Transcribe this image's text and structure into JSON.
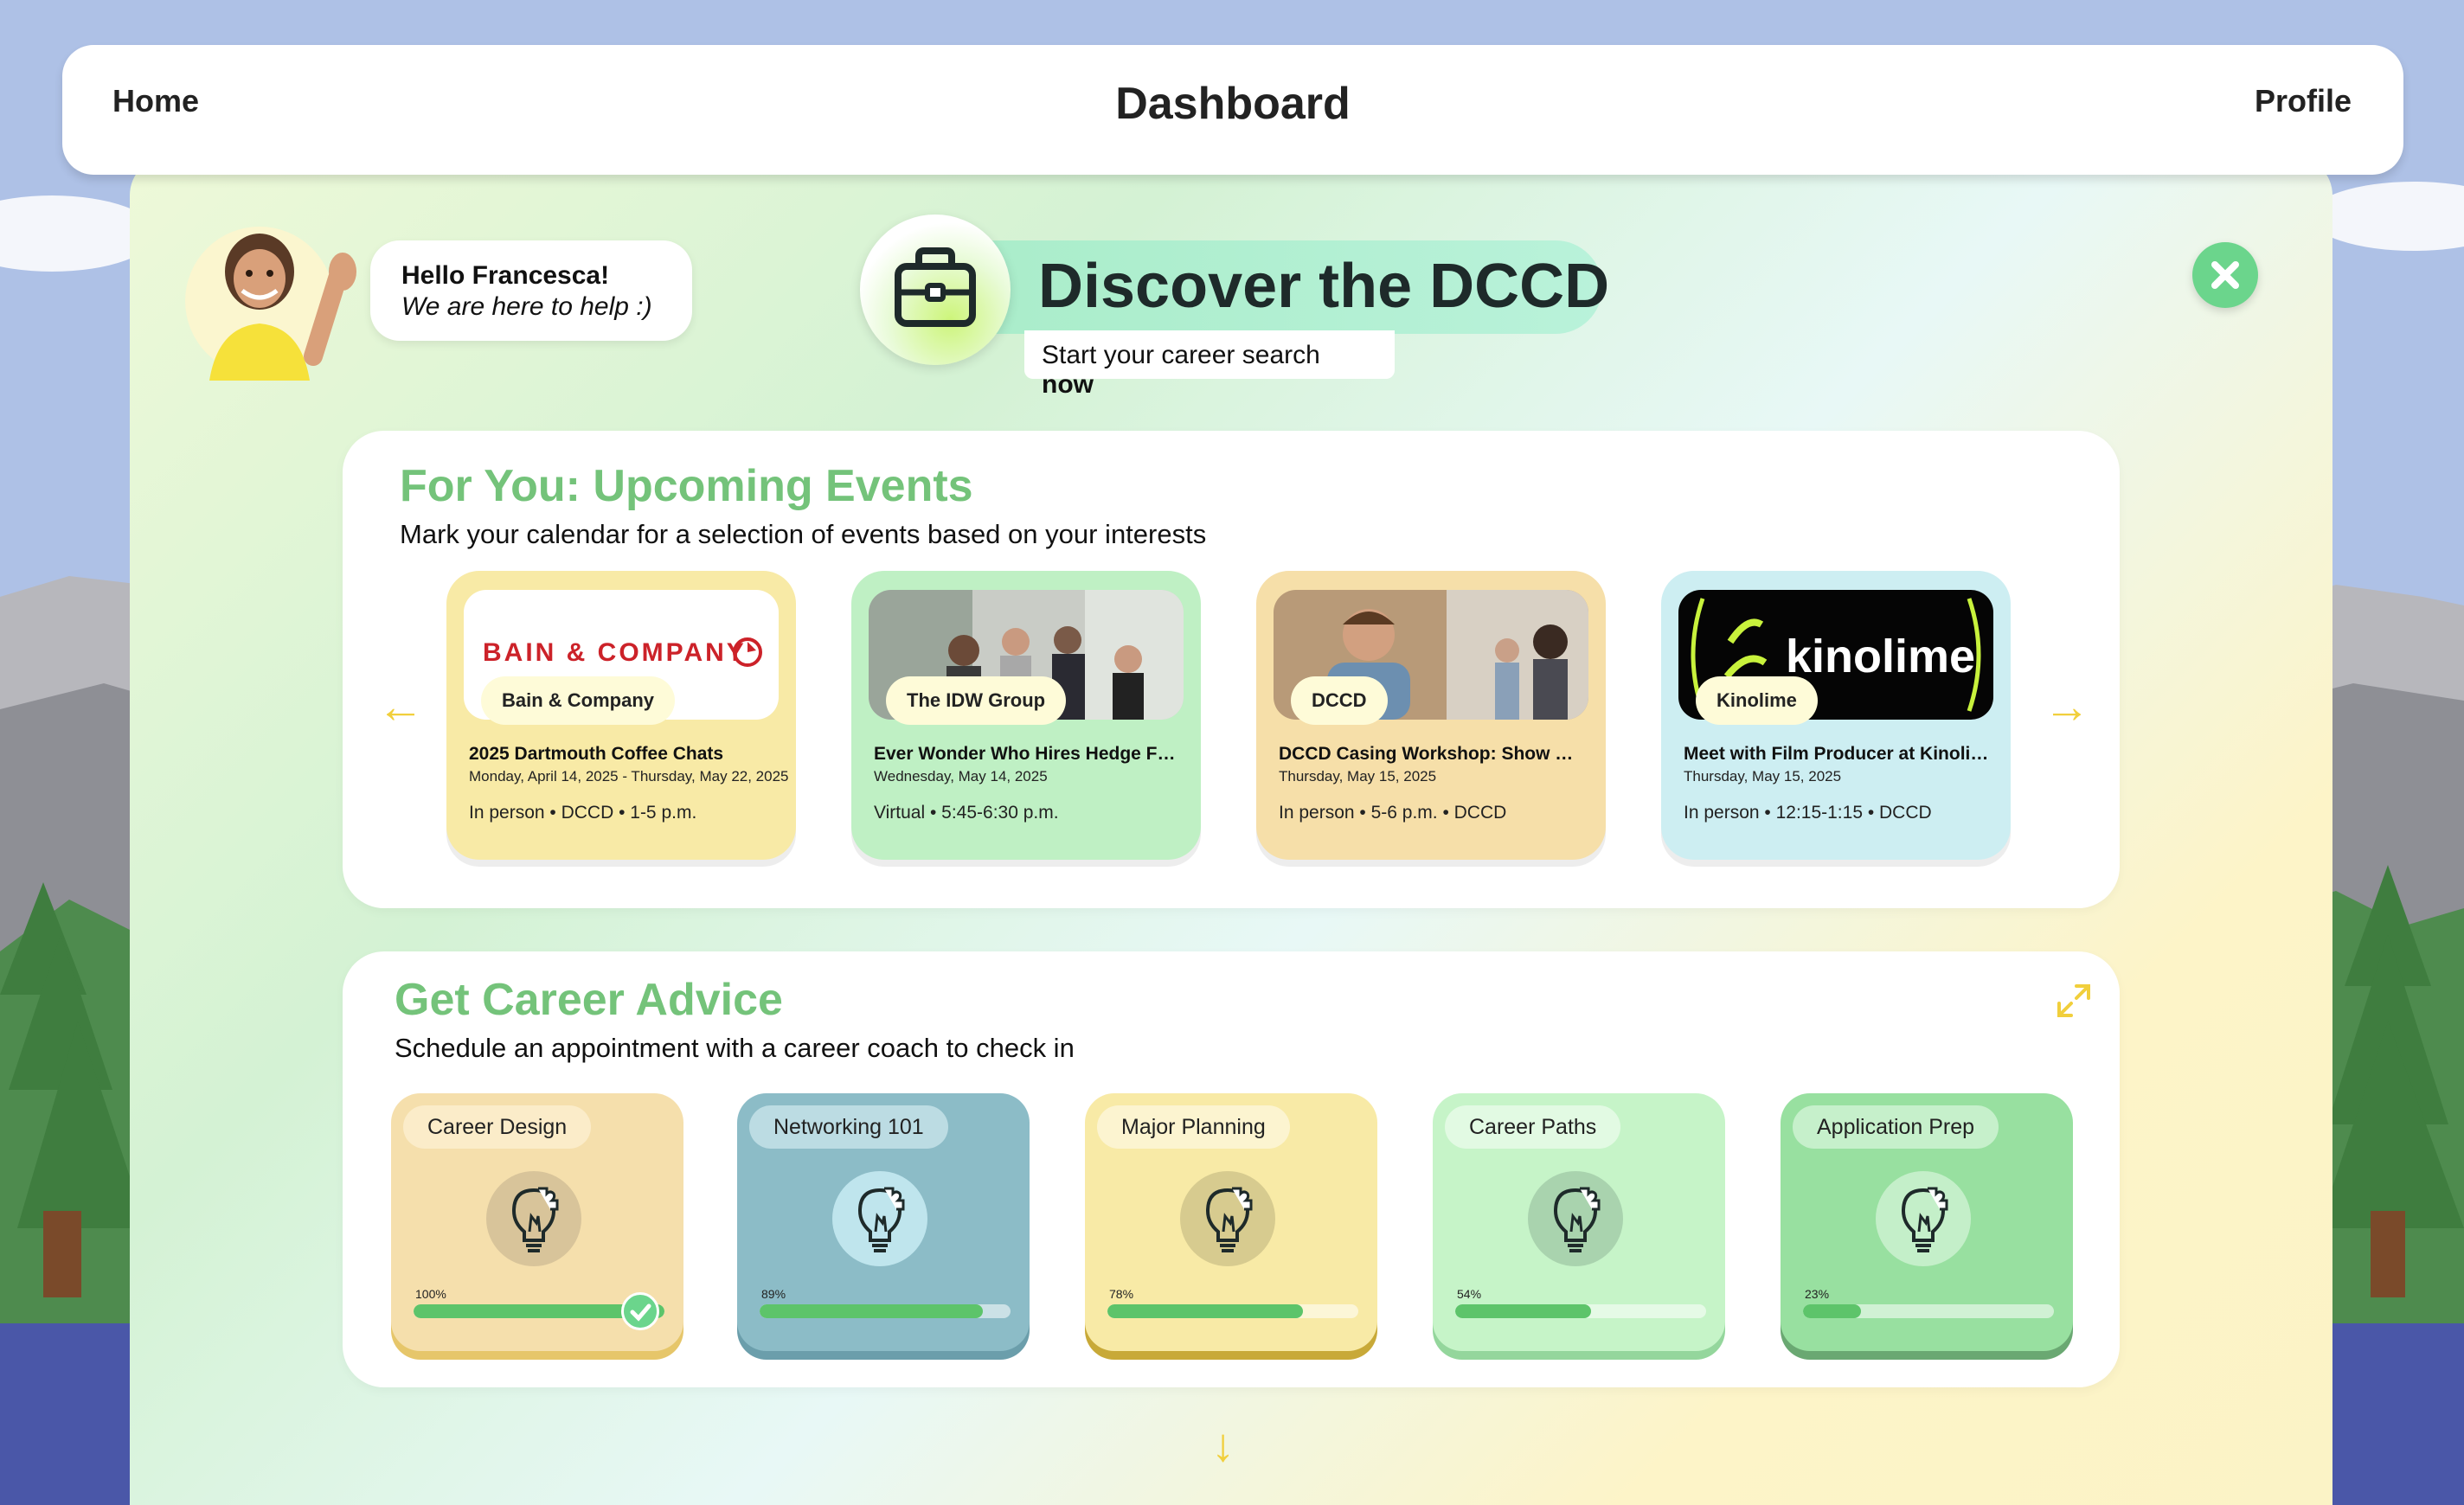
{
  "nav": {
    "home": "Home",
    "title": "Dashboard",
    "profile": "Profile"
  },
  "greeting": {
    "line1": "Hello Francesca!",
    "line2": "We are here to help :)"
  },
  "discover": {
    "title": "Discover the DCCD",
    "subtitle_prefix": "Start your career search ",
    "subtitle_emphasis": "now"
  },
  "events": {
    "title": "For You: Upcoming Events",
    "subtitle": "Mark your calendar for a selection of events based on your interests",
    "items": [
      {
        "logo_text": "BAIN & COMPANY",
        "tag": "Bain & Company",
        "title": "2025 Dartmouth Coffee Chats",
        "date": "Monday, April 14, 2025 - Thursday, May 22, 2025",
        "meta": "In person  •  DCCD  •  1-5 p.m.",
        "bg": "#f8eaa6"
      },
      {
        "tag": "The IDW Group",
        "title": "Ever Wonder Who Hires Hedge Fund Professionals?",
        "date": "Wednesday, May 14, 2025",
        "meta": "Virtual  •  5:45-6:30 p.m.",
        "bg": "#bff0c4"
      },
      {
        "tag": "DCCD",
        "title": "DCCD Casing Workshop: Show What You Know",
        "date": "Thursday, May 15, 2025",
        "meta": "In person  •  5-6 p.m.  •  DCCD",
        "bg": "#f6dfa9"
      },
      {
        "logo_text": "kinolime",
        "tag": "Kinolime",
        "title": "Meet with Film Producer at Kinolime",
        "date": "Thursday, May 15, 2025",
        "meta": "In person  •  12:15-1:15  •  DCCD",
        "bg": "#cdeef2"
      }
    ]
  },
  "advice": {
    "title": "Get Career Advice",
    "subtitle": "Schedule an appointment with a career coach to check in",
    "items": [
      {
        "label": "Career Design",
        "pct_label": "100%",
        "progress": 1.0,
        "bg": "#f5dfac",
        "edge": "#e6c66a",
        "chip": "#fbecc9",
        "icbg": "#d8c49a"
      },
      {
        "label": "Networking 101",
        "pct_label": "89%",
        "progress": 0.89,
        "bg": "#8cbcc7",
        "edge": "#6b9eab",
        "chip": "#bcdce3",
        "icbg": "#bfe5ed"
      },
      {
        "label": "Major Planning",
        "pct_label": "78%",
        "progress": 0.78,
        "bg": "#f8eaa6",
        "edge": "#c8a938",
        "chip": "#fcf4d0",
        "icbg": "#d7cb8f"
      },
      {
        "label": "Career Paths",
        "pct_label": "54%",
        "progress": 0.54,
        "bg": "#c6f4c8",
        "edge": "#94d69c",
        "chip": "#e2faE3",
        "icbg": "#a9d3ae"
      },
      {
        "label": "Application Prep",
        "pct_label": "23%",
        "progress": 0.23,
        "bg": "#98e0a0",
        "edge": "#6aa872",
        "chip": "#c6f0cb",
        "icbg": "#c4efc9"
      }
    ]
  }
}
